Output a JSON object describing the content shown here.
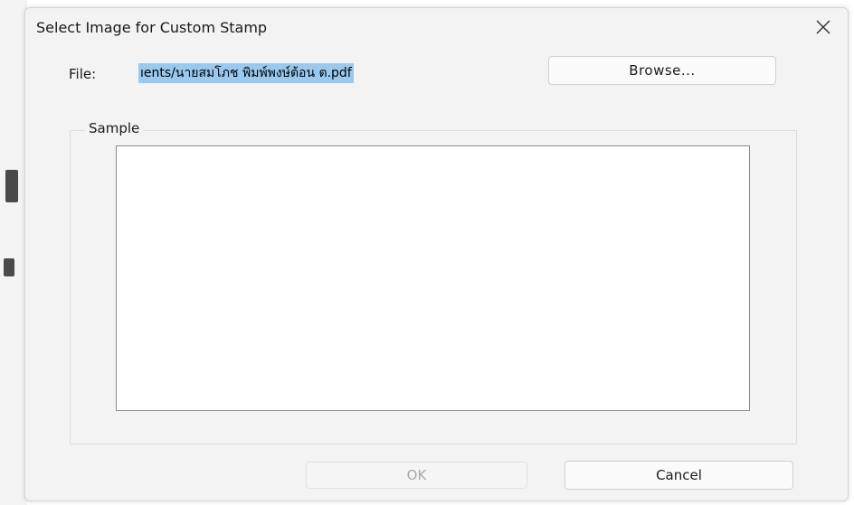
{
  "dialog": {
    "title": "Select Image for Custom Stamp",
    "close_icon": "close-icon"
  },
  "file": {
    "label": "File:",
    "value": "ıents/นายสมโภช พิมพ์พงษ์ต้อน ต.pdf",
    "browse_label": "Browse..."
  },
  "sample": {
    "legend": "Sample"
  },
  "footer": {
    "ok_label": "OK",
    "cancel_label": "Cancel",
    "ok_enabled": false
  },
  "colors": {
    "dialog_bg": "#f3f3f3",
    "selection_highlight": "#99c9ef",
    "disabled_text": "#a8a8a8"
  }
}
